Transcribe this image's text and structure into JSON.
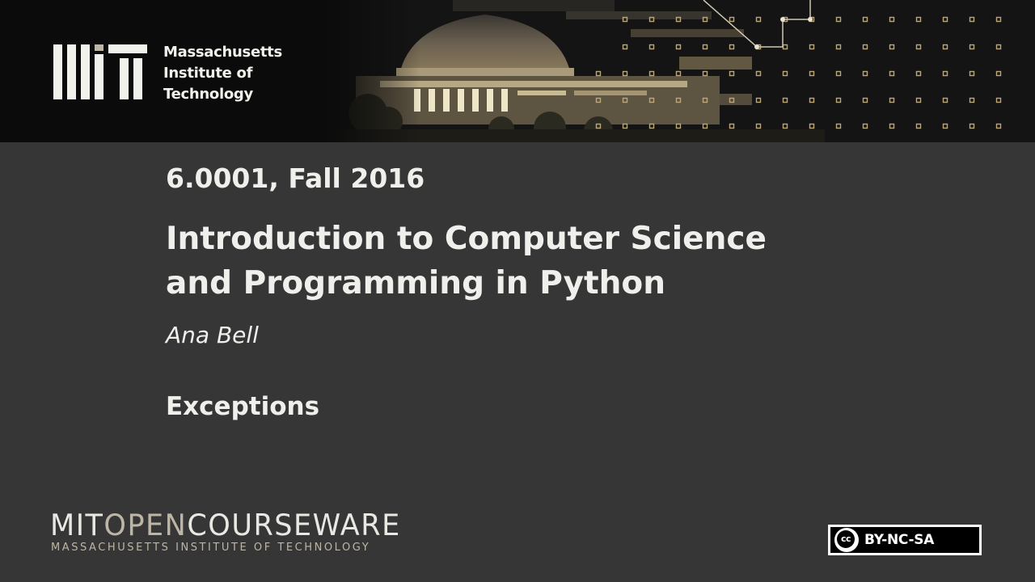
{
  "header": {
    "institution_lines": [
      "Massachusetts",
      "Institute of",
      "Technology"
    ]
  },
  "slide": {
    "course_number": "6.0001, Fall 2016",
    "course_title_lines": [
      "Introduction to Computer Science",
      "and Programming in Python"
    ],
    "instructor": "Ana Bell",
    "lecture_title": "Exceptions"
  },
  "footer": {
    "ocw_mit": "MIT",
    "ocw_open": "OPEN",
    "ocw_courseware": "COURSEWARE",
    "ocw_subtitle": "MASSACHUSETTS INSTITUTE OF TECHNOLOGY",
    "license_symbol": "cc",
    "license_terms": "BY-NC-SA"
  },
  "colors": {
    "background": "#363636",
    "banner": "#0b0b0b",
    "text": "#efefec",
    "ocw_accent": "#bdb6a6"
  }
}
